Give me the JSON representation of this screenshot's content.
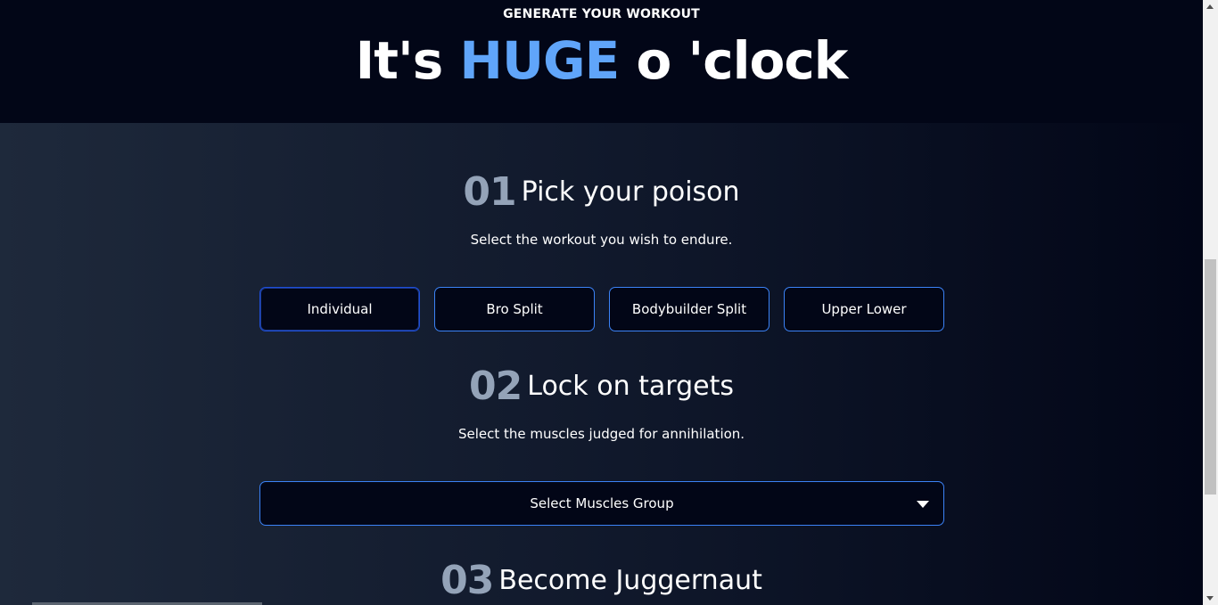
{
  "hero": {
    "eyebrow": "GENERATE YOUR WORKOUT",
    "title_prefix": "It's ",
    "title_accent": "HUGE",
    "title_suffix": " o 'clock"
  },
  "steps": [
    {
      "number": "01",
      "title": "Pick your poison",
      "description": "Select the workout you wish to endure.",
      "options": [
        "Individual",
        "Bro Split",
        "Bodybuilder Split",
        "Upper Lower"
      ]
    },
    {
      "number": "02",
      "title": "Lock on targets",
      "description": "Select the muscles judged for annihilation.",
      "select_label": "Select Muscles Group"
    },
    {
      "number": "03",
      "title": "Become Juggernaut"
    }
  ],
  "colors": {
    "accent": "#60a5fa",
    "border": "#3b82f6",
    "step_number": "#94a3b8"
  }
}
